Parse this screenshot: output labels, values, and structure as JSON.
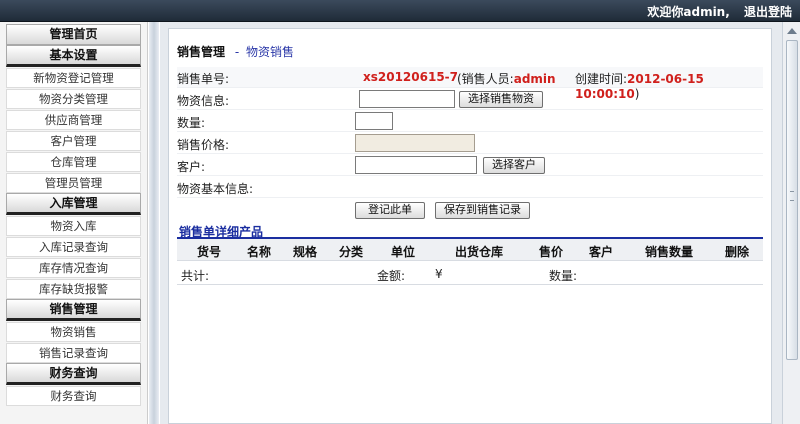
{
  "topbar": {
    "welcome": "欢迎你admin,",
    "logout": "退出登陆"
  },
  "sidebar": {
    "home": "管理首页",
    "groups": [
      {
        "title": "基本设置",
        "items": [
          "新物资登记管理",
          "物资分类管理",
          "供应商管理",
          "客户管理",
          "仓库管理",
          "管理员管理"
        ]
      },
      {
        "title": "入库管理",
        "items": [
          "物资入库",
          "入库记录查询",
          "库存情况查询",
          "库存缺货报警"
        ]
      },
      {
        "title": "销售管理",
        "items": [
          "物资销售",
          "销售记录查询"
        ]
      },
      {
        "title": "财务查询",
        "items": [
          "财务查询"
        ]
      }
    ]
  },
  "page": {
    "title_main": "销售管理",
    "title_sep": "-",
    "title_sub": "物资销售",
    "order_label": "销售单号:",
    "order_no": "xs20120615-7",
    "seller_prefix": "(销售人员:",
    "seller": "admin",
    "time_prefix": "创建时间:",
    "create_time": "2012-06-15 10:00:10",
    "time_suffix": ")",
    "goods_label": "物资信息:",
    "goods_button": "选择销售物资",
    "qty_label": "数量:",
    "price_label": "销售价格:",
    "customer_label": "客户:",
    "customer_button": "选择客户",
    "goods_info_label": "物资基本信息:",
    "register_button": "登记此单",
    "save_button": "保存到销售记录",
    "detail_title": "销售单详细产品",
    "columns": [
      "货号",
      "名称",
      "规格",
      "分类",
      "单位",
      "出货仓库",
      "售价",
      "客户",
      "销售数量",
      "删除"
    ],
    "total_label": "共计:",
    "amount_label": "金额:",
    "currency": "¥",
    "quantity_label": "数量:"
  }
}
